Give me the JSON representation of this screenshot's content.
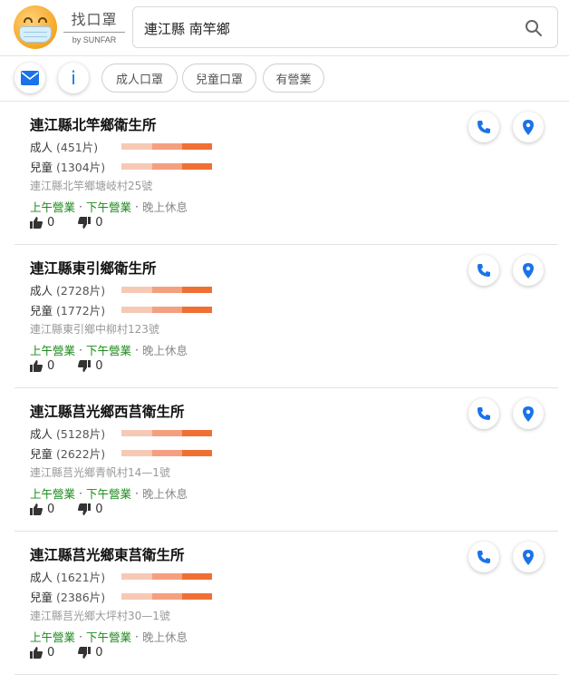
{
  "brand": {
    "title": "找口罩",
    "subtitle": "by SUNFAR"
  },
  "search": {
    "value": "連江縣 南竿鄉",
    "placeholder": ""
  },
  "filters": [
    "成人口罩",
    "兒童口罩",
    "有營業"
  ],
  "colors": {
    "accent": "#1a73e8",
    "open": "#1a8a1a",
    "bar_high": "#f07034",
    "bar_mid": "#f4a080",
    "bar_low": "#f6c9b5"
  },
  "icons": {
    "mail": "mail-icon",
    "info": "info-icon",
    "search": "search-icon",
    "phone": "phone-icon",
    "map": "map-pin-icon",
    "like": "thumbs-up-icon",
    "dislike": "thumbs-down-icon"
  },
  "results": [
    {
      "name": "連江縣北竿鄉衛生所",
      "adult_label": "成人",
      "adult_count": "(451片)",
      "child_label": "兒童",
      "child_count": "(1304片)",
      "address": "連江縣北竿鄉塘岐村25號",
      "morning": "上午營業",
      "afternoon": "下午營業",
      "evening": "晚上休息",
      "likes": "0",
      "dislikes": "0"
    },
    {
      "name": "連江縣東引鄉衛生所",
      "adult_label": "成人",
      "adult_count": "(2728片)",
      "child_label": "兒童",
      "child_count": "(1772片)",
      "address": "連江縣東引鄉中柳村123號",
      "morning": "上午營業",
      "afternoon": "下午營業",
      "evening": "晚上休息",
      "likes": "0",
      "dislikes": "0"
    },
    {
      "name": "連江縣莒光鄉西莒衛生所",
      "adult_label": "成人",
      "adult_count": "(5128片)",
      "child_label": "兒童",
      "child_count": "(2622片)",
      "address": "連江縣莒光鄉青帆村14—1號",
      "morning": "上午營業",
      "afternoon": "下午營業",
      "evening": "晚上休息",
      "likes": "0",
      "dislikes": "0"
    },
    {
      "name": "連江縣莒光鄉東莒衛生所",
      "adult_label": "成人",
      "adult_count": "(1621片)",
      "child_label": "兒童",
      "child_count": "(2386片)",
      "address": "連江縣莒光鄉大坪村30—1號",
      "morning": "上午營業",
      "afternoon": "下午營業",
      "evening": "晚上休息",
      "likes": "0",
      "dislikes": "0"
    }
  ]
}
